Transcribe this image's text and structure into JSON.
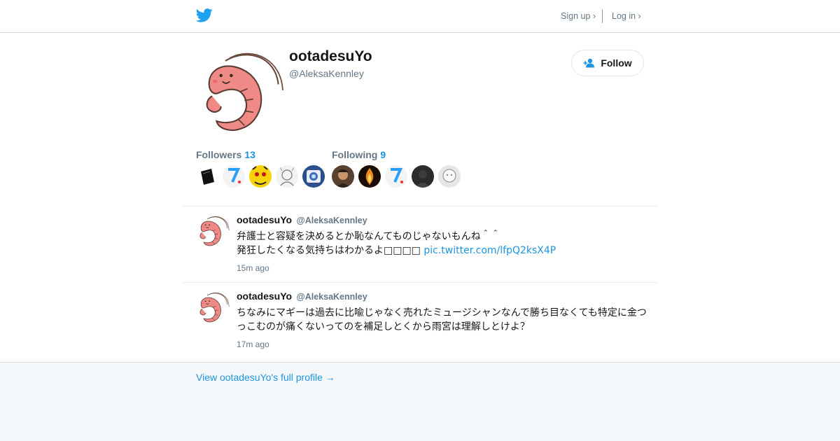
{
  "nav": {
    "logo_icon": "twitter-bird-icon",
    "signup_label": "Sign up ›",
    "login_label": "Log in ›"
  },
  "profile": {
    "display_name": "ootadesuYo",
    "screen_name": "@AleksaKennley",
    "avatar_icon": "shrimp-avatar",
    "follow_label": "Follow"
  },
  "stats": {
    "followers_label": "Followers",
    "followers_count": "13",
    "following_label": "Following",
    "following_count": "9"
  },
  "followers_avatars": [
    "dark-book",
    "number-7",
    "yellow-face",
    "sketch-figure",
    "camera-icon"
  ],
  "following_avatars": [
    "person-portrait",
    "fire-figure",
    "number-7",
    "dark-figure",
    "white-face"
  ],
  "tweets": [
    {
      "name": "ootadesuYo",
      "handle": "@AleksaKennley",
      "line1": "弁護士と容疑を決めるとか恥なんてものじゃないもんね＾＾",
      "line2": "発狂したくなる気持ちはわかるよ□□□□",
      "link": "pic.twitter.com/lfpQ2ksX4P",
      "time": "15m ago"
    },
    {
      "name": "ootadesuYo",
      "handle": "@AleksaKennley",
      "line1": "ちなみにマギーは過去に比喩じゃなく売れたミュージシャンなんで勝ち目なくても特定に金つ",
      "line2": "っこむのが痛くないってのを補足しとくから雨宮は理解しとけよ？",
      "time": "17m ago"
    }
  ],
  "footer": {
    "full_profile_label": "View ootadesuYo's full profile →"
  },
  "colors": {
    "accent": "#1b95e0",
    "secondary_text": "#657786",
    "footer_bg": "#f5f8fa"
  }
}
